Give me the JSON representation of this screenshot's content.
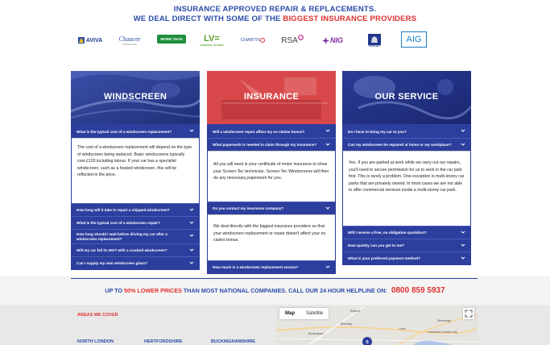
{
  "header": {
    "line1": "INSURANCE APPROVED REPAIR & REPLACEMENTS.",
    "line2_prefix": "WE DEAL DIRECT WITH SOME OF THE ",
    "line2_highlight": "BIGGEST INSURANCE PROVIDERS"
  },
  "logos": {
    "aviva": "AVIVA",
    "chaucer": "Chaucer",
    "chaucer_sub": "INSURANCE",
    "morethan": "MORE TH>N",
    "lv": "LV=",
    "lv_sub": "LIVERPOOL VICTORIA",
    "chartis": "CHARTIS",
    "rsa": "RSA",
    "nig": "NIG",
    "churchill": "CHURCHILL",
    "aig": "AIG"
  },
  "columns": {
    "windscreen": {
      "title": "WINDSCREEN",
      "q1": "What is the typical cost of a windscreen replacement?",
      "a1_p1": "The cost of a windscreen replacement will depend on the type of windscreen being replaced. Basic windscreens typically cost £120 including labour. If your car has a specialist windscreen, such as a heated windscreen, this will be reflected in the price.",
      "q2": "How long will it take to repair a chipped windscreen?",
      "q3": "What is the typical cost of a windscreen repair?",
      "q4": "How long should I wait before driving my car after a windscreen replacement?",
      "q5": "Will my car fail its MOT with a cracked windscreen?",
      "q6": "Can I supply my own windscreen glass?"
    },
    "insurance": {
      "title": "INSURANCE",
      "q1": "Will a windscreen repair affect my no claims bonus?",
      "q2": "What paperwork is needed to claim through my insurance?",
      "a2_p1": "All you will need is your certificate of motor insurance to show your Screen-Tec technician. Screen-Tec Windscreens will then do any necessary paperwork for you.",
      "q3": "Do you contact my insurance company?",
      "a3_p1": "We deal directly with the biggest insurance providers so that your windscreen replacement or repair doesn't affect your no claims bonus.",
      "q4": "How much is a windscreen replacement excess?"
    },
    "service": {
      "title": "OUR SERVICE",
      "q1": "Do I have to bring my car to you?",
      "q2": "Can my windscreen be repaired at home or my workplace?",
      "a2_p1": "Yes. If you are parked at work while we carry out our repairs, you'll need to secure permission for us to work in the car park first. This is rarely a problem. One exception is multi-storey car parks that are privately owned. In most cases we are not able to offer commercial services inside a multi-storey car park.",
      "q3": "Will I receive a free, no obligation quotation?",
      "q4": "How quickly can you get to me?",
      "q5": "What is your preferred payment method?"
    }
  },
  "promo": {
    "prefix": "UP TO ",
    "highlight": "50% LOWER PRICES",
    "middle": " THAN MOST NATIONAL COMPANIES. CALL OUR 24 HOUR HELPLINE ON: ",
    "phone": "0800 859 5937"
  },
  "footer": {
    "areas_title": "AREAS WE COVER",
    "area1": "NORTH LONDON",
    "area2": "HERTFORDSHIRE",
    "area3": "BUCKINGHAMSHIRE",
    "map_tab_map": "Map",
    "map_tab_satellite": "Satellite",
    "map_labels": [
      "Bedford",
      "Luton",
      "Stevenage",
      "Buckingham",
      "Bletchley",
      "Letchworth Garden City"
    ]
  },
  "colors": {
    "brand_blue": "#2c3f9e",
    "accent_red": "#e03030"
  }
}
